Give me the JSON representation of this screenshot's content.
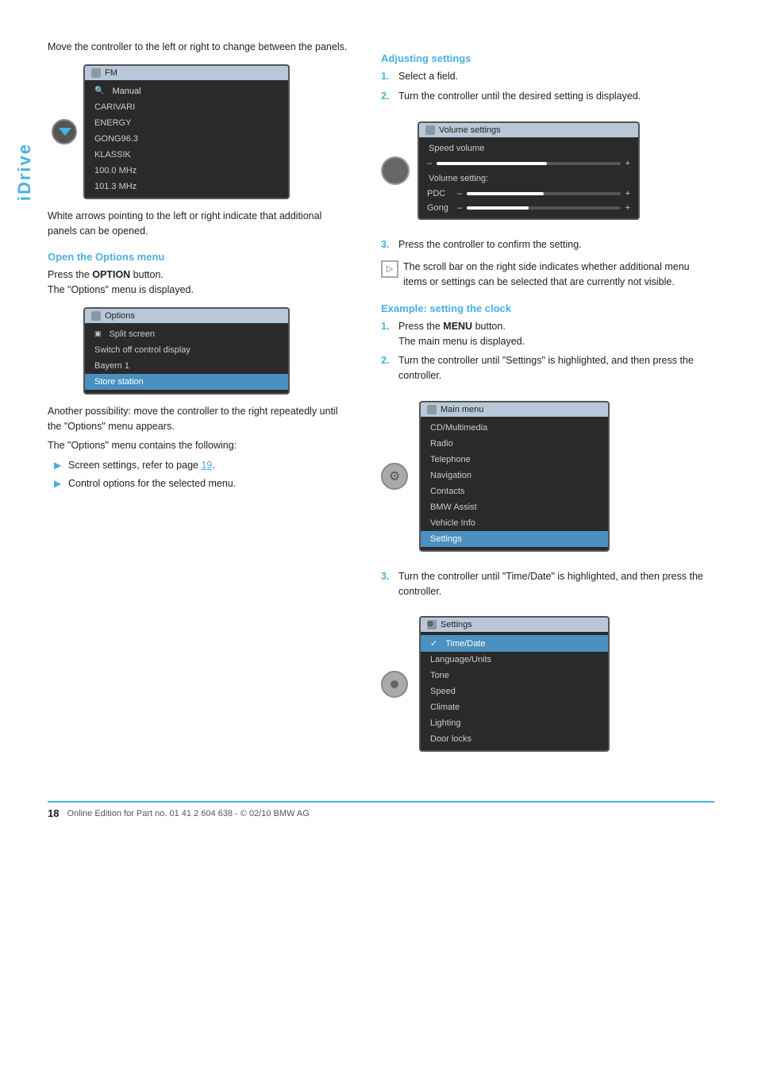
{
  "sidebar": {
    "label": "iDrive"
  },
  "left_col": {
    "intro_text": "Move the controller to the left or right to change between the panels.",
    "fm_screen": {
      "title": "FM",
      "rows": [
        {
          "text": "Manual",
          "icon": "search",
          "type": "manual"
        },
        {
          "text": "CARIVARI",
          "type": "normal"
        },
        {
          "text": "ENERGY",
          "type": "normal"
        },
        {
          "text": "GONG96.3",
          "type": "normal"
        },
        {
          "text": "KLASSIK",
          "type": "normal"
        },
        {
          "text": "100.0 MHz",
          "type": "normal"
        },
        {
          "text": "101.3 MHz",
          "type": "normal"
        }
      ]
    },
    "white_arrows_text": "White arrows pointing to the left or right indicate that additional panels can be opened.",
    "open_options_heading": "Open the Options menu",
    "open_options_text1": "Press the ",
    "open_options_bold": "OPTION",
    "open_options_text2": " button.",
    "open_options_text3": "The \"Options\" menu is displayed.",
    "options_screen": {
      "title": "Options",
      "rows": [
        {
          "text": "Split screen",
          "icon": "split",
          "type": "normal"
        },
        {
          "text": "Switch off control display",
          "type": "normal"
        },
        {
          "text": "Bayern 1",
          "type": "normal"
        },
        {
          "text": "Store station",
          "type": "selected"
        }
      ]
    },
    "another_text": "Another possibility: move the controller to the right repeatedly until the \"Options\" menu appears.",
    "contains_heading": "The \"Options\" menu contains the following:",
    "bullet1": "Screen settings, refer to page 19.",
    "bullet1_link": "19",
    "bullet2": "Control options for the selected menu."
  },
  "right_col": {
    "adjusting_heading": "Adjusting settings",
    "steps": [
      {
        "num": "1.",
        "text": "Select a field."
      },
      {
        "num": "2.",
        "text": "Turn the controller until the desired setting is displayed."
      }
    ],
    "volume_screen": {
      "title": "Volume settings",
      "rows": [
        {
          "label": "Speed volume",
          "type": "header"
        },
        {
          "label": "–",
          "fill": 60,
          "plus": "+",
          "type": "slider"
        },
        {
          "label": "Volume setting:",
          "type": "section"
        },
        {
          "label": "PDC",
          "fill": 50,
          "plus": "+",
          "type": "slider"
        },
        {
          "label": "Gong",
          "fill": 40,
          "plus": "+",
          "type": "slider"
        }
      ]
    },
    "step3_text": "Press the controller to confirm the setting.",
    "scroll_indicator_text": "The scroll bar on the right side indicates whether additional menu items or settings can be selected that are currently not visible.",
    "example_heading": "Example: setting the clock",
    "example_steps": [
      {
        "num": "1.",
        "text": "Press the ",
        "bold": "MENU",
        "text2": " button.\nThe main menu is displayed."
      },
      {
        "num": "2.",
        "text": "Turn the controller until \"Settings\" is highlighted, and then press the controller."
      }
    ],
    "main_menu_screen": {
      "title": "Main menu",
      "rows": [
        {
          "text": "CD/Multimedia",
          "type": "normal"
        },
        {
          "text": "Radio",
          "type": "normal"
        },
        {
          "text": "Telephone",
          "type": "normal"
        },
        {
          "text": "Navigation",
          "type": "normal"
        },
        {
          "text": "Contacts",
          "type": "normal"
        },
        {
          "text": "BMW Assist",
          "type": "normal"
        },
        {
          "text": "Vehicle Info",
          "type": "normal"
        },
        {
          "text": "Settings",
          "type": "selected"
        }
      ]
    },
    "step3b_text": "Turn the controller until \"Time/Date\" is highlighted, and then press the controller.",
    "settings_screen": {
      "title": "Settings",
      "rows": [
        {
          "text": "Time/Date",
          "type": "selected",
          "check": true
        },
        {
          "text": "Language/Units",
          "type": "normal"
        },
        {
          "text": "Tone",
          "type": "normal"
        },
        {
          "text": "Speed",
          "type": "normal"
        },
        {
          "text": "Climate",
          "type": "normal"
        },
        {
          "text": "Lighting",
          "type": "normal"
        },
        {
          "text": "Door locks",
          "type": "normal"
        }
      ]
    }
  },
  "footer": {
    "page_number": "18",
    "footer_text": "Online Edition for Part no. 01 41 2 604 638 - © 02/10 BMW AG"
  }
}
